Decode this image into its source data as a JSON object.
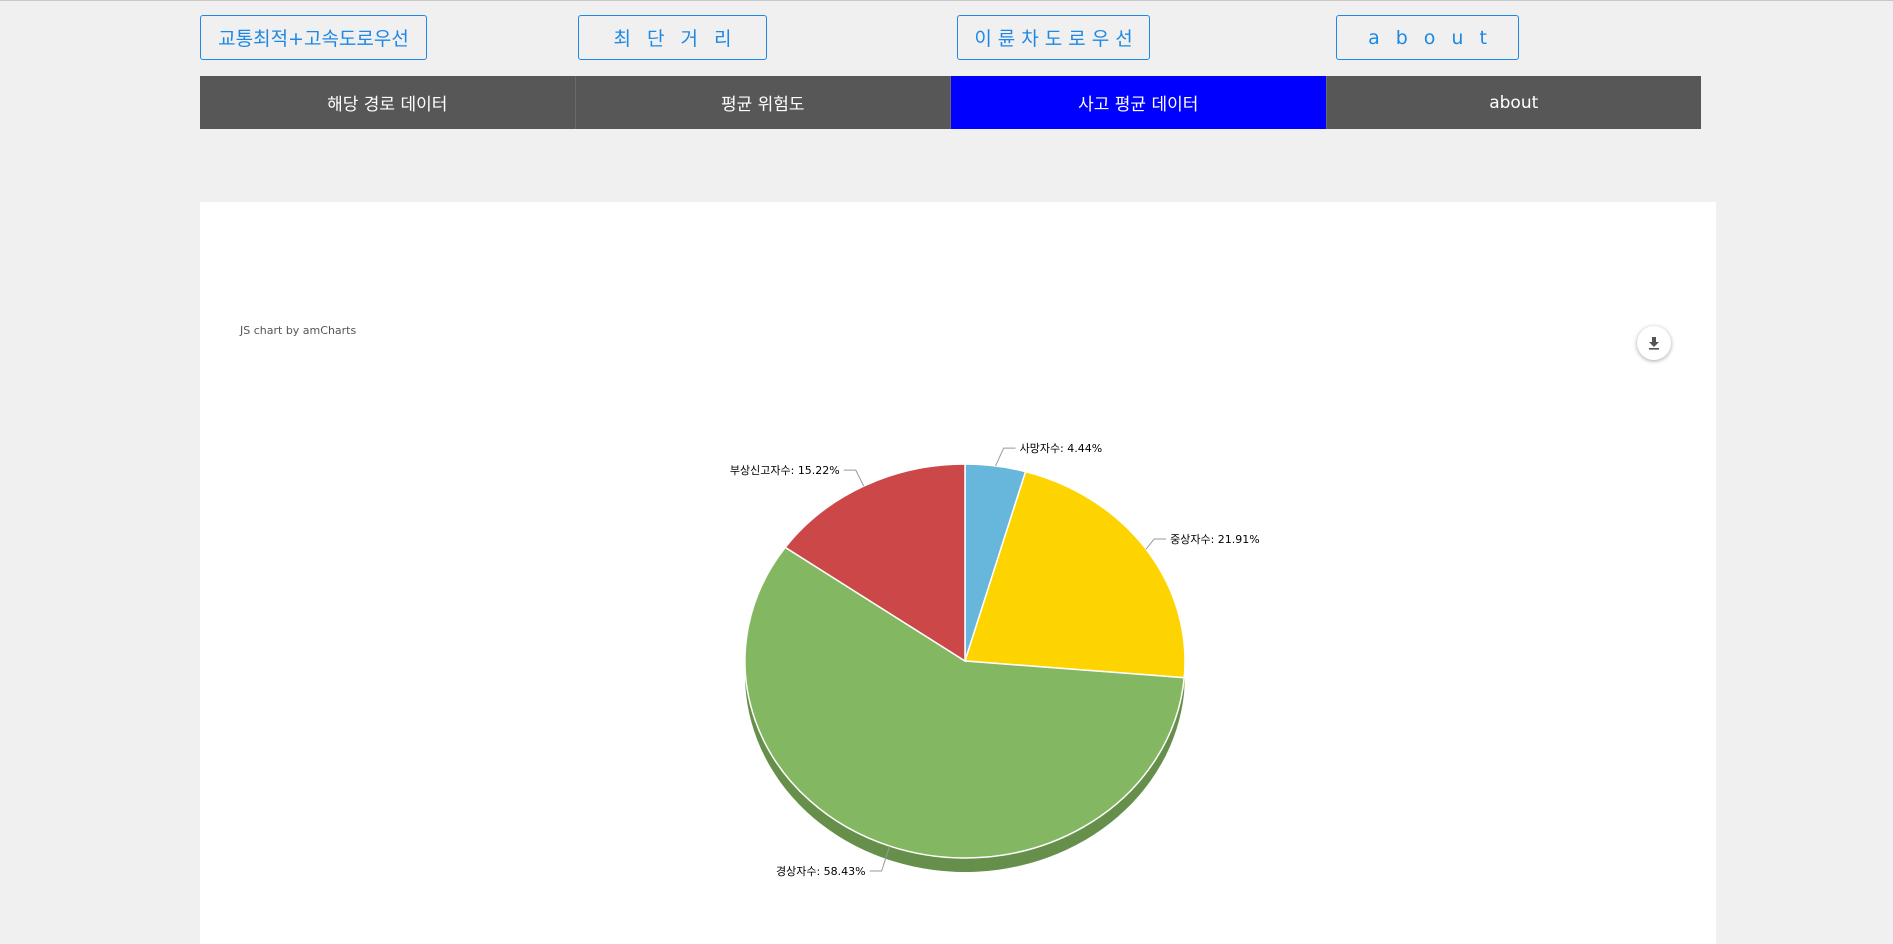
{
  "top_buttons": [
    {
      "label": "교통최적+고속도로우선"
    },
    {
      "label": "최단거리"
    },
    {
      "label": "이륜차도로우선"
    },
    {
      "label": "about"
    }
  ],
  "nav": {
    "items": [
      {
        "label": "해당 경로 데이터"
      },
      {
        "label": "평균 위험도"
      },
      {
        "label": "사고 평균 데이터"
      },
      {
        "label": "about"
      }
    ],
    "active_index": 2
  },
  "chart": {
    "credit": "JS chart by amCharts",
    "export_icon": "download-icon"
  },
  "chart_data": {
    "type": "pie",
    "slices": [
      {
        "label": "사망자수: 4.44%",
        "category": "사망자수",
        "value": 4.44,
        "color": "#67b7dc"
      },
      {
        "label": "중상자수: 21.91%",
        "category": "중상자수",
        "value": 21.91,
        "color": "#fdd400"
      },
      {
        "label": "경상자수: 58.43%",
        "category": "경상자수",
        "value": 58.43,
        "color": "#84b761"
      },
      {
        "label": "부상신고자수: 15.22%",
        "category": "부상신고자수",
        "value": 15.22,
        "color": "#cc4748"
      }
    ]
  }
}
